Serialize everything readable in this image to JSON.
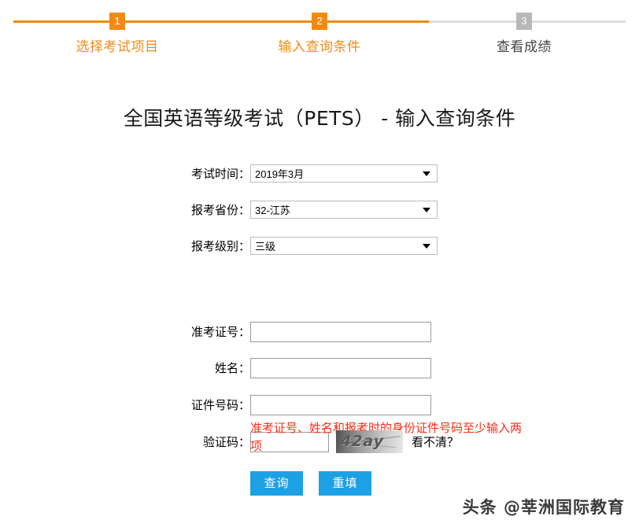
{
  "stepper": {
    "steps": [
      {
        "number": "1",
        "label": "选择考试项目",
        "state": "active"
      },
      {
        "number": "2",
        "label": "输入查询条件",
        "state": "active"
      },
      {
        "number": "3",
        "label": "查看成绩",
        "state": "inactive"
      }
    ],
    "active_color": "#f18a16",
    "inactive_color": "#b7b7b7",
    "line_done_color": "#ec8a10",
    "line_todo_color": "#dcdcdc"
  },
  "page": {
    "title": "全国英语等级考试（PETS） - 输入查询条件"
  },
  "form": {
    "exam_time": {
      "label": "考试时间：",
      "value": "2019年3月"
    },
    "province": {
      "label": "报考省份：",
      "value": "32-江苏"
    },
    "level": {
      "label": "报考级别：",
      "value": "三级"
    },
    "warning": "准考证号、姓名和报考时的身份证件号码至少输入两项",
    "warning_color": "#ff2a15",
    "admission_no": {
      "label": "准考证号：",
      "value": "",
      "placeholder": ""
    },
    "name": {
      "label": "姓名：",
      "value": "",
      "placeholder": ""
    },
    "id_no": {
      "label": "证件号码：",
      "value": "",
      "placeholder": ""
    },
    "captcha": {
      "label": "验证码：",
      "value": "",
      "placeholder": "",
      "image_text": "42ay",
      "refresh_label": "看不清？"
    },
    "buttons": {
      "submit": "查询",
      "reset": "重填",
      "color": "#1da1e5"
    }
  },
  "watermark": {
    "text": "头条 @莘洲国际教育"
  }
}
